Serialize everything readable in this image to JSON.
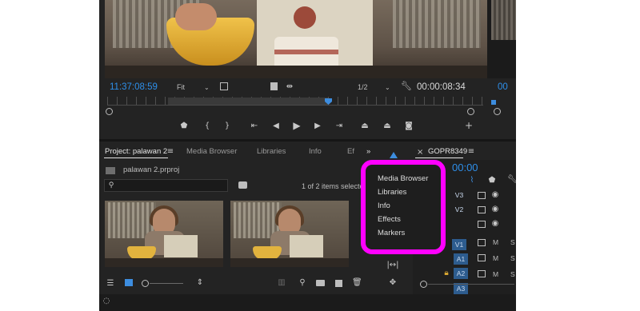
{
  "program_monitor": {
    "current_timecode": "11:37:08:59",
    "fit_label": "Fit",
    "resolution_label": "1/2",
    "duration_timecode": "00:00:08:34",
    "right_timecode_partial": "00"
  },
  "transport": {
    "marker_icon": "marker-icon",
    "in_icon": "mark-in-icon",
    "out_icon": "mark-out-icon",
    "goto_in_icon": "go-to-in-icon",
    "step_back_icon": "step-back-icon",
    "play_icon": "play-icon",
    "step_forward_icon": "step-forward-icon",
    "goto_out_icon": "go-to-out-icon",
    "lift_icon": "lift-icon",
    "extract_icon": "extract-icon",
    "export_frame_icon": "camera-icon",
    "add_icon": "plus-icon"
  },
  "project_panel": {
    "tabs": [
      {
        "label": "Project: palawan 2"
      },
      {
        "label": "Media Browser"
      },
      {
        "label": "Libraries"
      },
      {
        "label": "Info"
      },
      {
        "label": "Ef"
      }
    ],
    "overflow_label": "»",
    "project_file": "palawan 2.prproj",
    "items_selected": "1 of 2 items selecte",
    "search_placeholder": ""
  },
  "sequence_panel": {
    "tab_label": "GOPR8349",
    "timecode_partial": "00:00",
    "tracks": [
      {
        "label": "V3"
      },
      {
        "label": "V2"
      },
      {
        "label": "V1"
      },
      {
        "label": "A1"
      },
      {
        "label": "A2"
      },
      {
        "label": "A3"
      }
    ],
    "mute_label": "M",
    "solo_label": "S"
  },
  "overflow_menu": {
    "items": [
      {
        "label": "Media Browser"
      },
      {
        "label": "Libraries"
      },
      {
        "label": "Info"
      },
      {
        "label": "Effects"
      },
      {
        "label": "Markers"
      }
    ],
    "highlight_color": "#ff00ff"
  },
  "colors": {
    "timecode_blue": "#2e8fea",
    "panel_bg": "#232323",
    "track_blue": "#2d5c8e"
  }
}
